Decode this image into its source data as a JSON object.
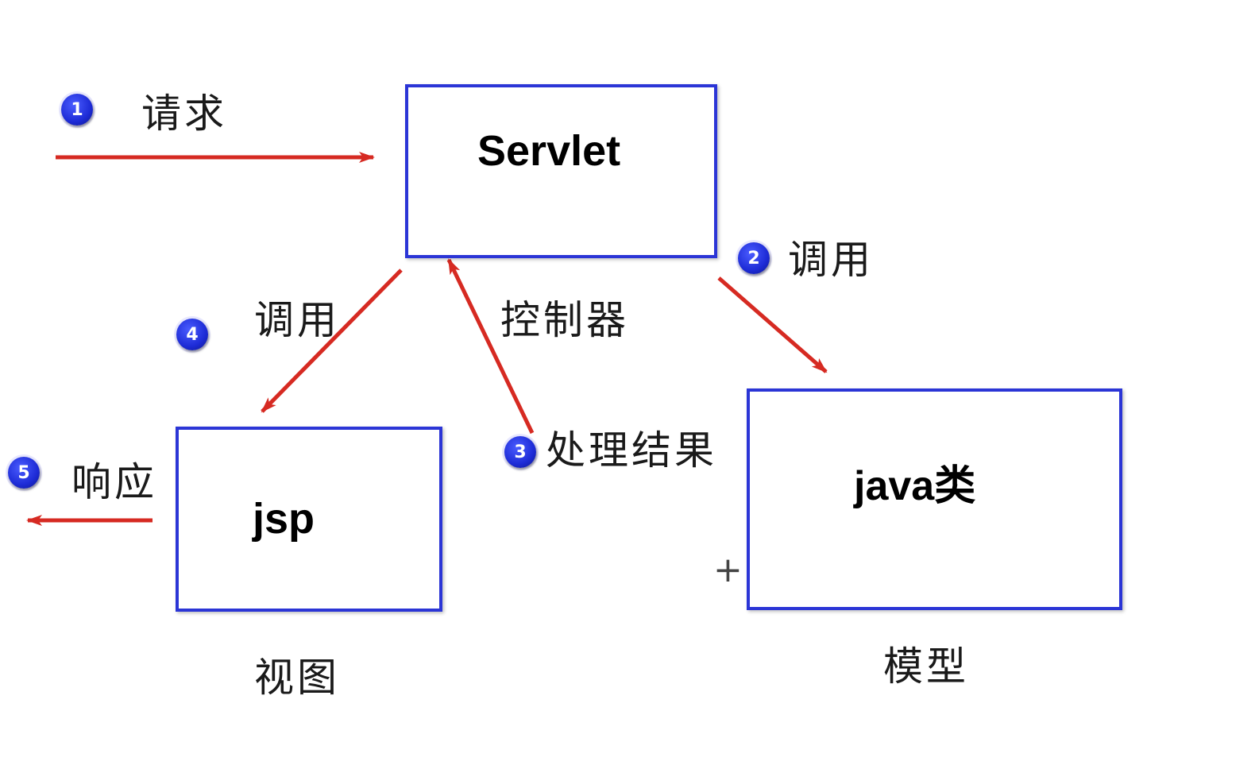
{
  "steps": {
    "request": {
      "number": "1",
      "label": "请求"
    },
    "invoke_model": {
      "number": "2",
      "label": "调用"
    },
    "result": {
      "number": "3",
      "label": "处理结果"
    },
    "invoke_view": {
      "number": "4",
      "label": "调用"
    },
    "response": {
      "number": "5",
      "label": "响应"
    }
  },
  "nodes": {
    "servlet": {
      "title": "Servlet",
      "caption": "控制器"
    },
    "jsp": {
      "title": "jsp",
      "caption": "视图"
    },
    "model": {
      "title": "java类",
      "caption": "模型"
    }
  },
  "cursor": "+",
  "colors": {
    "box_border": "#2b35d6",
    "arrow": "#d62a22",
    "badge": "#1d2bd6"
  }
}
